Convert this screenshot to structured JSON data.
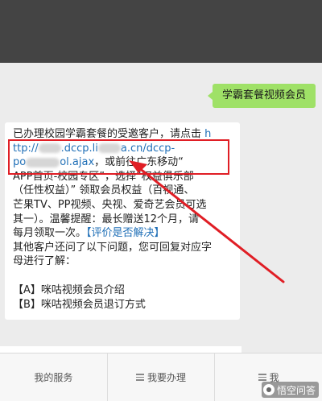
{
  "chat": {
    "user_message": "学霸套餐视频会员",
    "bot_reply": {
      "line1_text": "已办理校园学霸套餐的受邀客户，请点击",
      "line1_link": "h",
      "line2_link_a": "ttp://",
      "line2_link_b": ".dccp.li",
      "line2_link_c": "a.cn/dccp-",
      "line3_link_a": "po",
      "line3_link_b": "ol.ajax",
      "line3_text": "，或前往广东移动“",
      "line4": "APP首页-校园专区”，选择“权益俱乐部",
      "line5": "（任性权益）” 领取会员权益（百视通、",
      "line6": "芒果TV、PP视频、央视、爱奇艺会员可选",
      "line7": "其一）。温馨提醒：最长赠送12个月，请",
      "line8_text": "每月领取一次。",
      "line8_link": "【评价是否解决】",
      "line9": "其他客户还问了以下问题，您可回复对应字",
      "line10": "母进行了解：",
      "option_a": "【A】咪咕视频会员介绍",
      "option_b": "【B】咪咕视频会员退订方式"
    }
  },
  "bottom_bar": {
    "tabs": [
      {
        "label": "我的服务"
      },
      {
        "label": "我要办理"
      },
      {
        "label": "我"
      }
    ]
  },
  "watermark": {
    "text": "悟空问答"
  },
  "colors": {
    "user_bubble": "#9fe167",
    "link": "#1f6fb7",
    "annotation": "#e01e25"
  }
}
